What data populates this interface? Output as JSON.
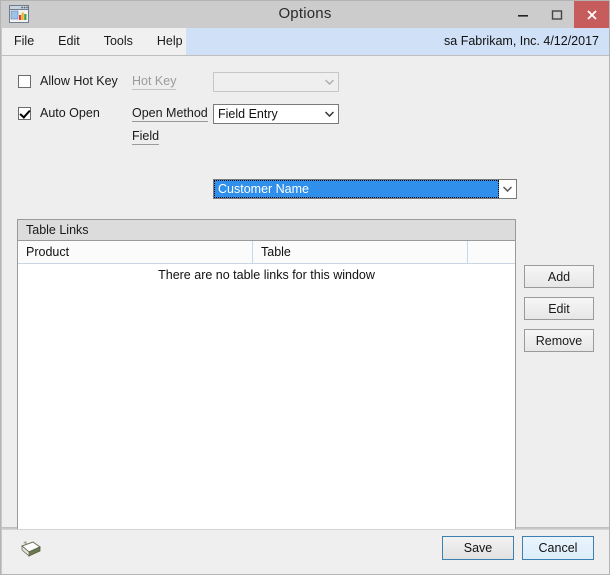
{
  "window": {
    "title": "Options",
    "icon": "dynamics-window-chart-icon",
    "minimize_label": "Minimize",
    "maximize_label": "Maximize",
    "close_label": "Close"
  },
  "menubar": {
    "items": [
      {
        "label": "File"
      },
      {
        "label": "Edit"
      },
      {
        "label": "Tools"
      },
      {
        "label": "Help"
      }
    ],
    "status": "sa  Fabrikam, Inc.  4/12/2017"
  },
  "options": {
    "allow_hot_key": {
      "label": "Allow Hot Key",
      "checked": false
    },
    "auto_open": {
      "label": "Auto Open",
      "checked": true
    },
    "hot_key": {
      "label": "Hot Key",
      "value": "",
      "disabled": true
    },
    "open_method": {
      "label": "Open Method",
      "value": "Field Entry"
    },
    "field": {
      "label": "Field",
      "value": "Customer Name",
      "selected": true
    }
  },
  "table_links": {
    "caption": "Table Links",
    "columns": [
      "Product",
      "Table",
      ""
    ],
    "rows": [],
    "empty_message": "There are no table links for this window",
    "buttons": {
      "add": "Add",
      "edit": "Edit",
      "remove": "Remove"
    }
  },
  "footer": {
    "note_icon": "note-icon",
    "save": "Save",
    "cancel": "Cancel"
  },
  "colors": {
    "titlebar": "#cccccc",
    "close_button": "#c75c5c",
    "status_strip": "#cfe0f7",
    "body": "#eeeeee",
    "selection": "#2f8fea",
    "group_caption": "#dcdcdc",
    "focus_border": "#3c7fb1"
  }
}
